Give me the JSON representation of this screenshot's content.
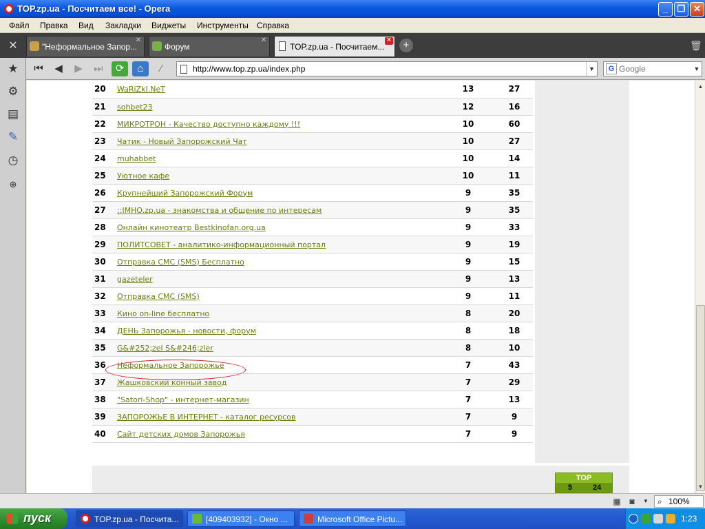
{
  "window": {
    "title": "TOP.zp.ua - Посчитаем все! - Opera"
  },
  "menu": [
    "Файл",
    "Правка",
    "Вид",
    "Закладки",
    "Виджеты",
    "Инструменты",
    "Справка"
  ],
  "tabs": [
    {
      "label": "\"Неформальное Запор...",
      "active": false
    },
    {
      "label": "Форум",
      "active": false
    },
    {
      "label": "TOP.zp.ua - Посчитаем...",
      "active": true
    }
  ],
  "address": {
    "url": "http://www.top.zp.ua/index.php",
    "search_placeholder": "Google"
  },
  "table_rows": [
    {
      "rank": "20",
      "name": "WaRiZkI.NeT",
      "v1": "13",
      "v2": "27"
    },
    {
      "rank": "21",
      "name": "sohbet23",
      "v1": "12",
      "v2": "16"
    },
    {
      "rank": "22",
      "name": "МИКРОТРОН - Качество доступно каждому !!!",
      "v1": "10",
      "v2": "60"
    },
    {
      "rank": "23",
      "name": "Чатик - Новый Запорожский Чат",
      "v1": "10",
      "v2": "27"
    },
    {
      "rank": "24",
      "name": "muhabbet",
      "v1": "10",
      "v2": "14"
    },
    {
      "rank": "25",
      "name": "Уютное кафе",
      "v1": "10",
      "v2": "11"
    },
    {
      "rank": "26",
      "name": "Крупнейший Запорожский Форум",
      "v1": "9",
      "v2": "35"
    },
    {
      "rank": "27",
      "name": "::IMHO.zp.ua - знакомства и общение по интересам",
      "v1": "9",
      "v2": "35"
    },
    {
      "rank": "28",
      "name": "Онлайн кинотеатр Bestkinofan.org.ua",
      "v1": "9",
      "v2": "33"
    },
    {
      "rank": "29",
      "name": "ПОЛИТСОВЕТ - аналитико-информационный портал",
      "v1": "9",
      "v2": "19"
    },
    {
      "rank": "30",
      "name": "Отправка СМС (SMS) Бесплатно",
      "v1": "9",
      "v2": "15"
    },
    {
      "rank": "31",
      "name": "gazeteler",
      "v1": "9",
      "v2": "13"
    },
    {
      "rank": "32",
      "name": "Отправка СМС (SMS)",
      "v1": "9",
      "v2": "11"
    },
    {
      "rank": "33",
      "name": "Кино on-line бесплатно",
      "v1": "8",
      "v2": "20"
    },
    {
      "rank": "34",
      "name": "ДЕНЬ Запорожья - новости, форум",
      "v1": "8",
      "v2": "18"
    },
    {
      "rank": "35",
      "name": "G&#252;zel S&#246;zler",
      "v1": "8",
      "v2": "10"
    },
    {
      "rank": "36",
      "name": "Неформальное Запорожье",
      "v1": "7",
      "v2": "43"
    },
    {
      "rank": "37",
      "name": "Жашковский конный завод",
      "v1": "7",
      "v2": "29"
    },
    {
      "rank": "38",
      "name": "\"Satori-Shop\" - интернет-магазин",
      "v1": "7",
      "v2": "13"
    },
    {
      "rank": "39",
      "name": "ЗАПОРОЖЬЕ В ИНТЕРНЕТ - каталог ресурсов",
      "v1": "7",
      "v2": "9"
    },
    {
      "rank": "40",
      "name": "Сайт детских домов Запорожья",
      "v1": "7",
      "v2": "9"
    }
  ],
  "top_badge": {
    "title": "TOP",
    "left": "5",
    "right": "24"
  },
  "status": {
    "zoom": "100%"
  },
  "taskbar": {
    "start": "пуск",
    "tasks": [
      {
        "label": "TOP.zp.ua - Посчита...",
        "active": true
      },
      {
        "label": "[409403932] - Окно ...",
        "active": false
      },
      {
        "label": "Microsoft Office Pictu...",
        "active": false
      }
    ],
    "clock": "1:23"
  },
  "colors": {
    "link": "#6b7d0b",
    "highlight": "#c8202a",
    "badge": "#8bbd22",
    "taskbar": "#245ad0"
  }
}
